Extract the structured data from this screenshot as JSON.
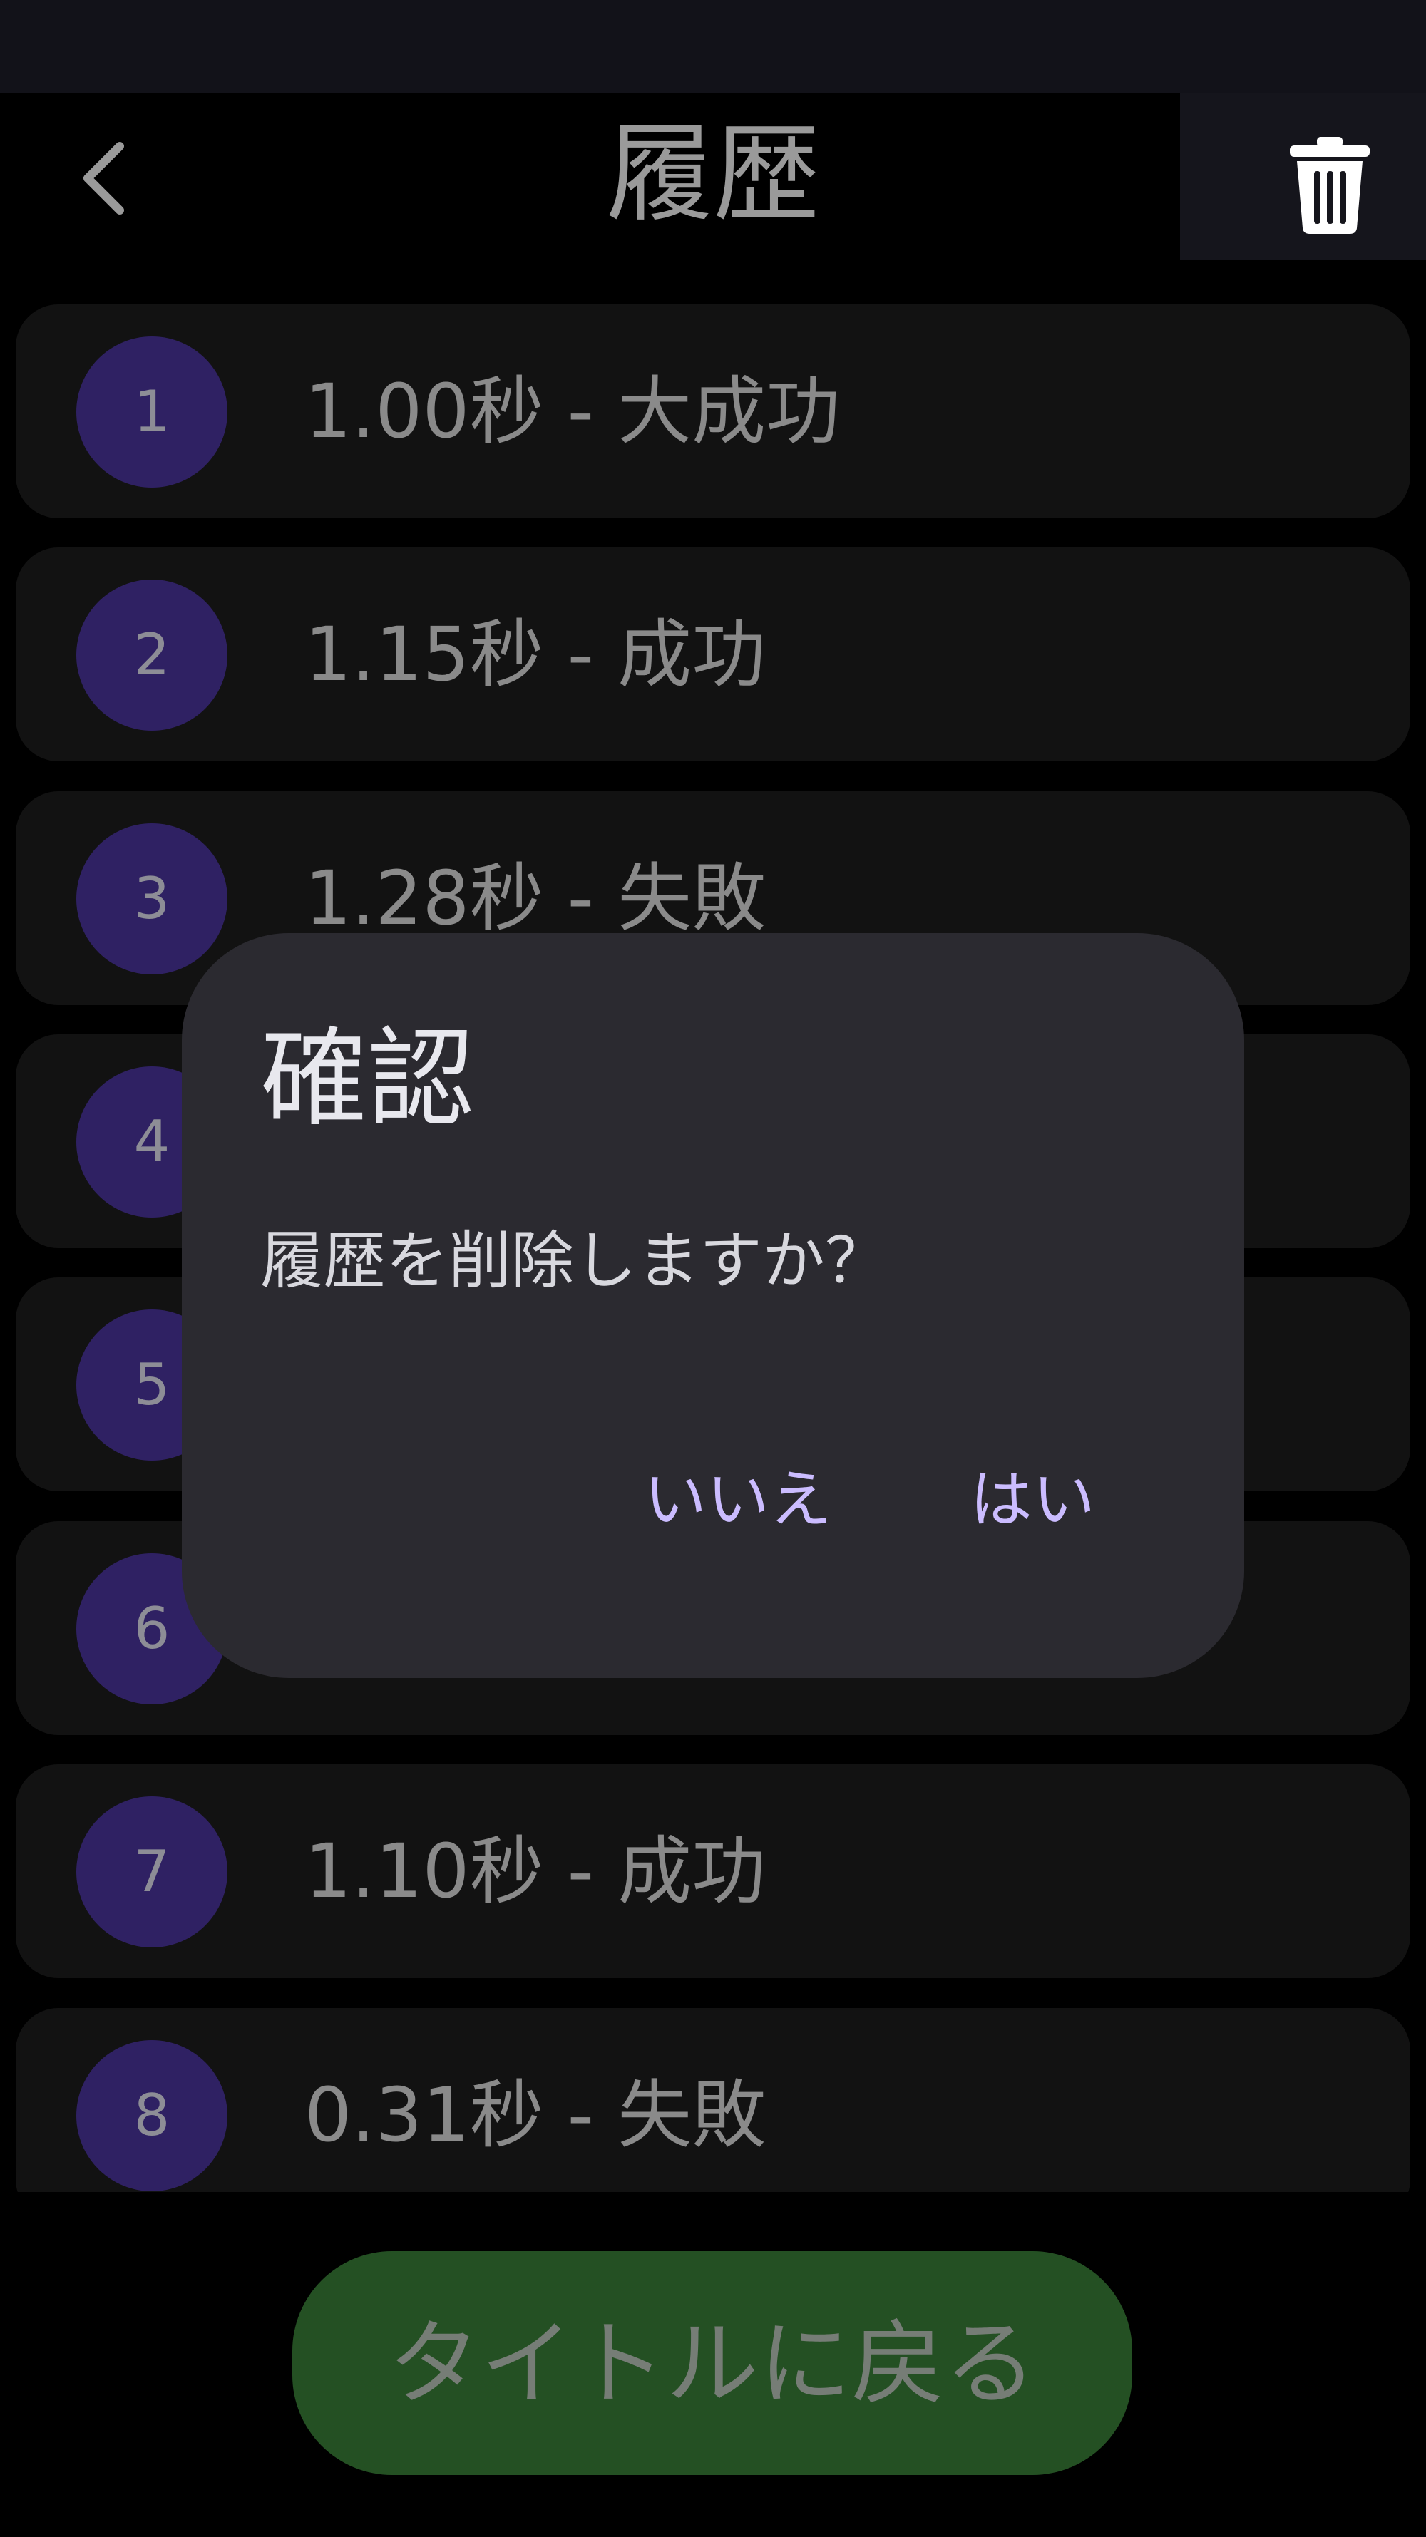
{
  "header": {
    "title": "履歴",
    "back_icon": "chevron-left-icon",
    "trash_icon": "trash-icon"
  },
  "history": [
    {
      "index": "1",
      "text": "1.00秒 - 大成功"
    },
    {
      "index": "2",
      "text": "1.15秒 - 成功"
    },
    {
      "index": "3",
      "text": "1.28秒 - 失敗"
    },
    {
      "index": "4",
      "text": ""
    },
    {
      "index": "5",
      "text": ""
    },
    {
      "index": "6",
      "text": ""
    },
    {
      "index": "7",
      "text": "1.10秒 - 成功"
    },
    {
      "index": "8",
      "text": "0.31秒 - 失敗"
    }
  ],
  "footer": {
    "home_button_label": "タイトルに戻る"
  },
  "dialog": {
    "title": "確認",
    "message": "履歴を削除しますか？",
    "no_label": "いいえ",
    "yes_label": "はい"
  },
  "colors": {
    "background": "#000000",
    "row_background": "#121212",
    "badge": "#2f2163",
    "home_button": "#245023",
    "dialog_background": "#2b2a30",
    "dialog_button_text": "#cbbcff"
  }
}
